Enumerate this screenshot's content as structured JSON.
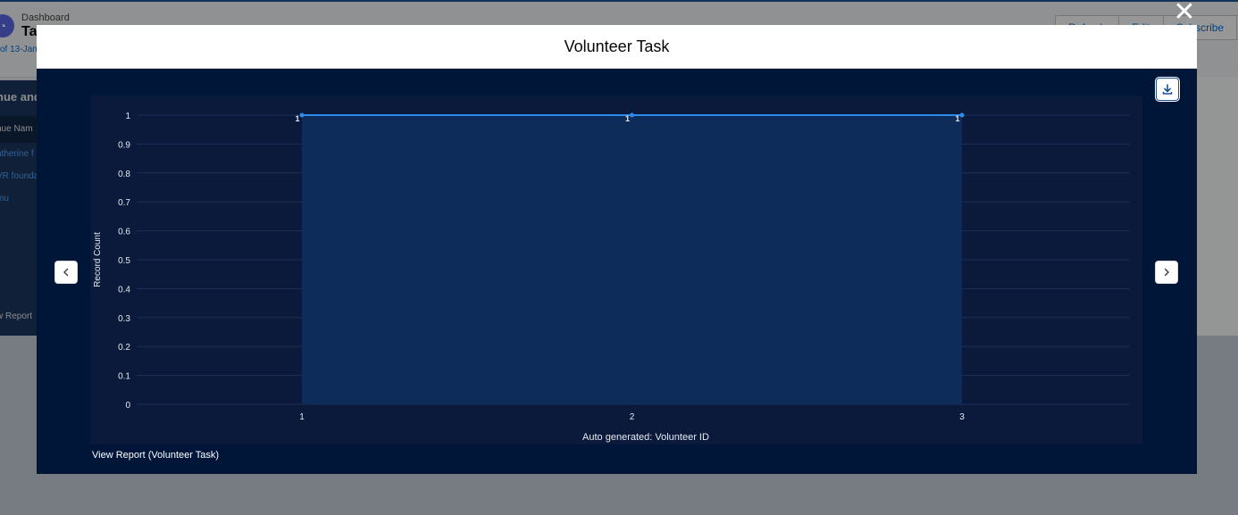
{
  "background": {
    "breadcrumb": "Dashboard",
    "title": "Ta",
    "subtitle": "of 13-Jan",
    "buttons": [
      "Refresh",
      "Edit",
      "Subscribe"
    ],
    "card_title": "nue and",
    "card_column": "nue Nam",
    "card_rows": [
      "atherine f",
      "VR founda",
      "mu"
    ],
    "card_link": "w Report"
  },
  "modal": {
    "title": "Volunteer Task",
    "close_glyph": "✕",
    "view_report": "View Report (Volunteer Task)",
    "icons": {
      "close": "close-icon",
      "download": "download-icon",
      "prev": "chevron-left-icon",
      "next": "chevron-right-icon"
    }
  },
  "colors": {
    "modal_body": "#001639",
    "chart_bg": "#0b1a3b",
    "area_fill": "#0f2d5c",
    "line": "#2f8bea",
    "grid": "#1d2f55",
    "text": "#e5e9ef"
  },
  "chart_data": {
    "type": "area",
    "categories": [
      "1",
      "2",
      "3"
    ],
    "values": [
      1,
      1,
      1
    ],
    "data_labels": [
      "1",
      "1",
      "1"
    ],
    "xlabel": "Auto generated: Volunteer ID",
    "ylabel": "Record Count",
    "ylim": [
      0,
      1
    ],
    "y_ticks": [
      "0",
      "0.1",
      "0.2",
      "0.3",
      "0.4",
      "0.5",
      "0.6",
      "0.7",
      "0.8",
      "0.9",
      "1"
    ],
    "grid": true
  }
}
